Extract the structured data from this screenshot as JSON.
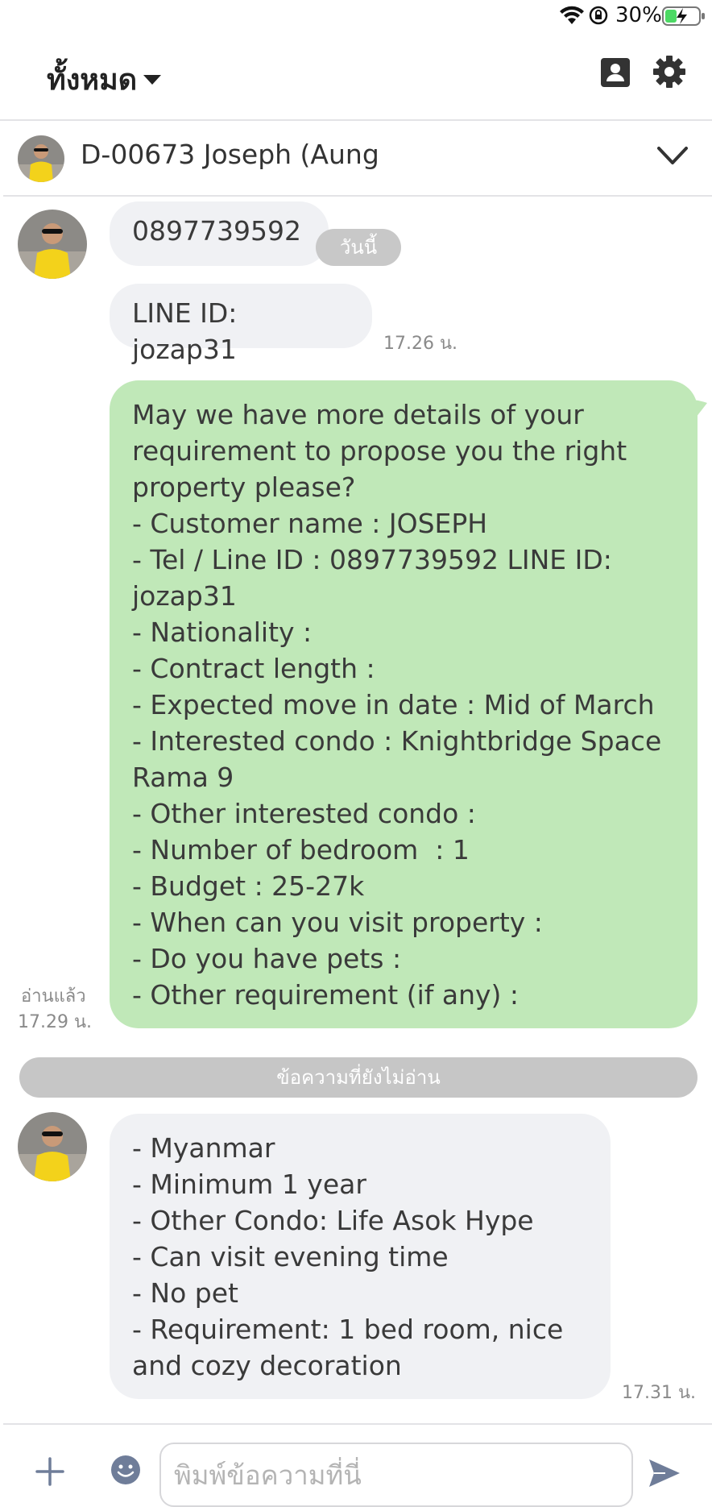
{
  "status_bar": {
    "battery_percent": "30%",
    "icons": [
      "wifi-icon",
      "rotation-lock-icon",
      "battery-charging-icon"
    ]
  },
  "header": {
    "filter_label": "ทั้งหมด",
    "icons": [
      "caret-down-icon",
      "contacts-icon",
      "gear-icon"
    ]
  },
  "chat": {
    "name": "D-00673 Joseph (Aung",
    "icons": [
      "chevron-down-icon"
    ]
  },
  "messages": {
    "m1": {
      "text": "0897739592"
    },
    "date_chip": "วันนี้",
    "m2": {
      "text": "LINE ID: jozap31",
      "time": "17.26 น."
    },
    "m3": {
      "lines": [
        "May we have more details of your",
        "requirement to propose you the right",
        "property please?",
        "- Customer name : JOSEPH",
        "- Tel / Line ID : 0897739592 LINE ID:",
        "jozap31",
        "- Nationality :",
        "- Contract length :",
        "- Expected move in date : Mid of March",
        "- Interested condo : Knightbridge Space",
        "Rama 9",
        "- Other interested condo :",
        "- Number of bedroom  : 1",
        "- Budget : 25-27k",
        "- When can you visit property :",
        "- Do you have pets :",
        "- Other requirement (if any) :"
      ],
      "read_label": "อ่านแล้ว",
      "time": "17.29 น."
    },
    "unread_divider": "ข้อความที่ยังไม่อ่าน",
    "m4": {
      "lines": [
        "- Myanmar",
        "- Minimum 1 year",
        "- Other Condo: Life Asok Hype",
        "- Can visit evening time",
        "- No pet",
        "- Requirement: 1 bed room, nice",
        "and cozy decoration"
      ],
      "time": "17.31 น."
    }
  },
  "composer": {
    "placeholder": "พิมพ์ข้อความที่นี่",
    "icons": [
      "plus-icon",
      "emoji-icon",
      "send-icon"
    ]
  },
  "colors": {
    "incoming_bubble": "#f0f1f4",
    "outgoing_bubble": "#c0e8b8",
    "chip": "#c8c8c8",
    "send_icon": "#6f7d99"
  }
}
